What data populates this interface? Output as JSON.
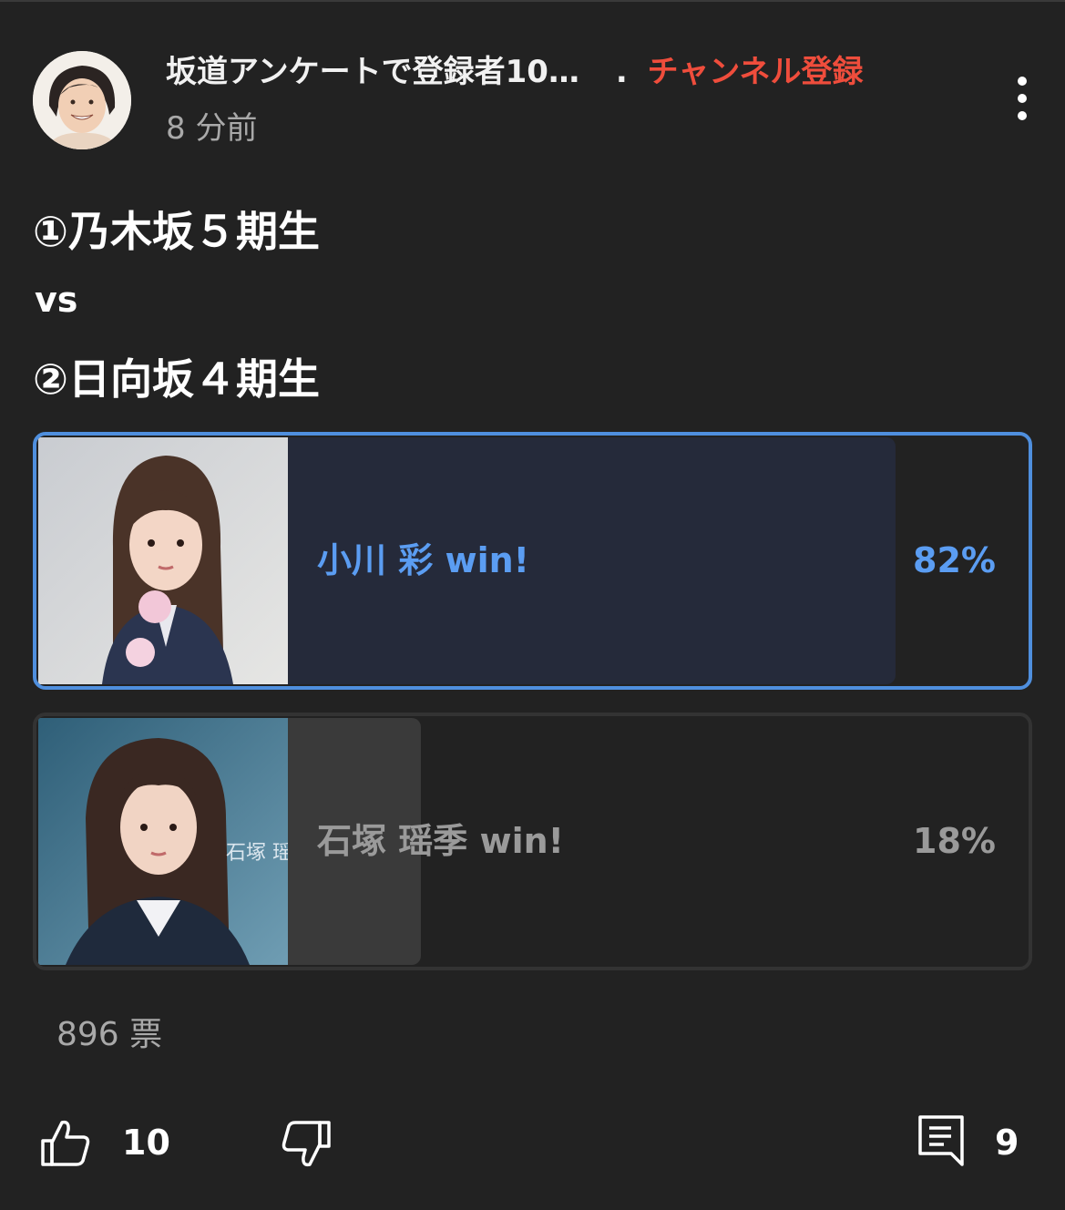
{
  "header": {
    "channel_name": "坂道アンケートで登録者10…",
    "separator": ".",
    "subscribe_label": "チャンネル登録",
    "time_ago": "8 分前"
  },
  "post": {
    "line1": "①乃木坂５期生",
    "line2": "vs",
    "line3": "②日向坂４期生"
  },
  "poll": {
    "options": [
      {
        "label": "小川 彩 win!",
        "percent_text": "82%",
        "percent": 82,
        "selected": true,
        "text_color": "#5b9df2",
        "fill_color": "#252a3a"
      },
      {
        "label": "石塚 瑶季 win!",
        "percent_text": "18%",
        "percent": 18,
        "selected": false,
        "text_color": "#9a9a9a",
        "fill_color": "#3a3a3a",
        "photo_caption": "石塚 瑶"
      }
    ],
    "votes": "896 票"
  },
  "actions": {
    "like_count": "10",
    "comment_count": "9"
  },
  "icons": [
    "menu-icon",
    "like-icon",
    "dislike-icon",
    "comment-icon"
  ]
}
